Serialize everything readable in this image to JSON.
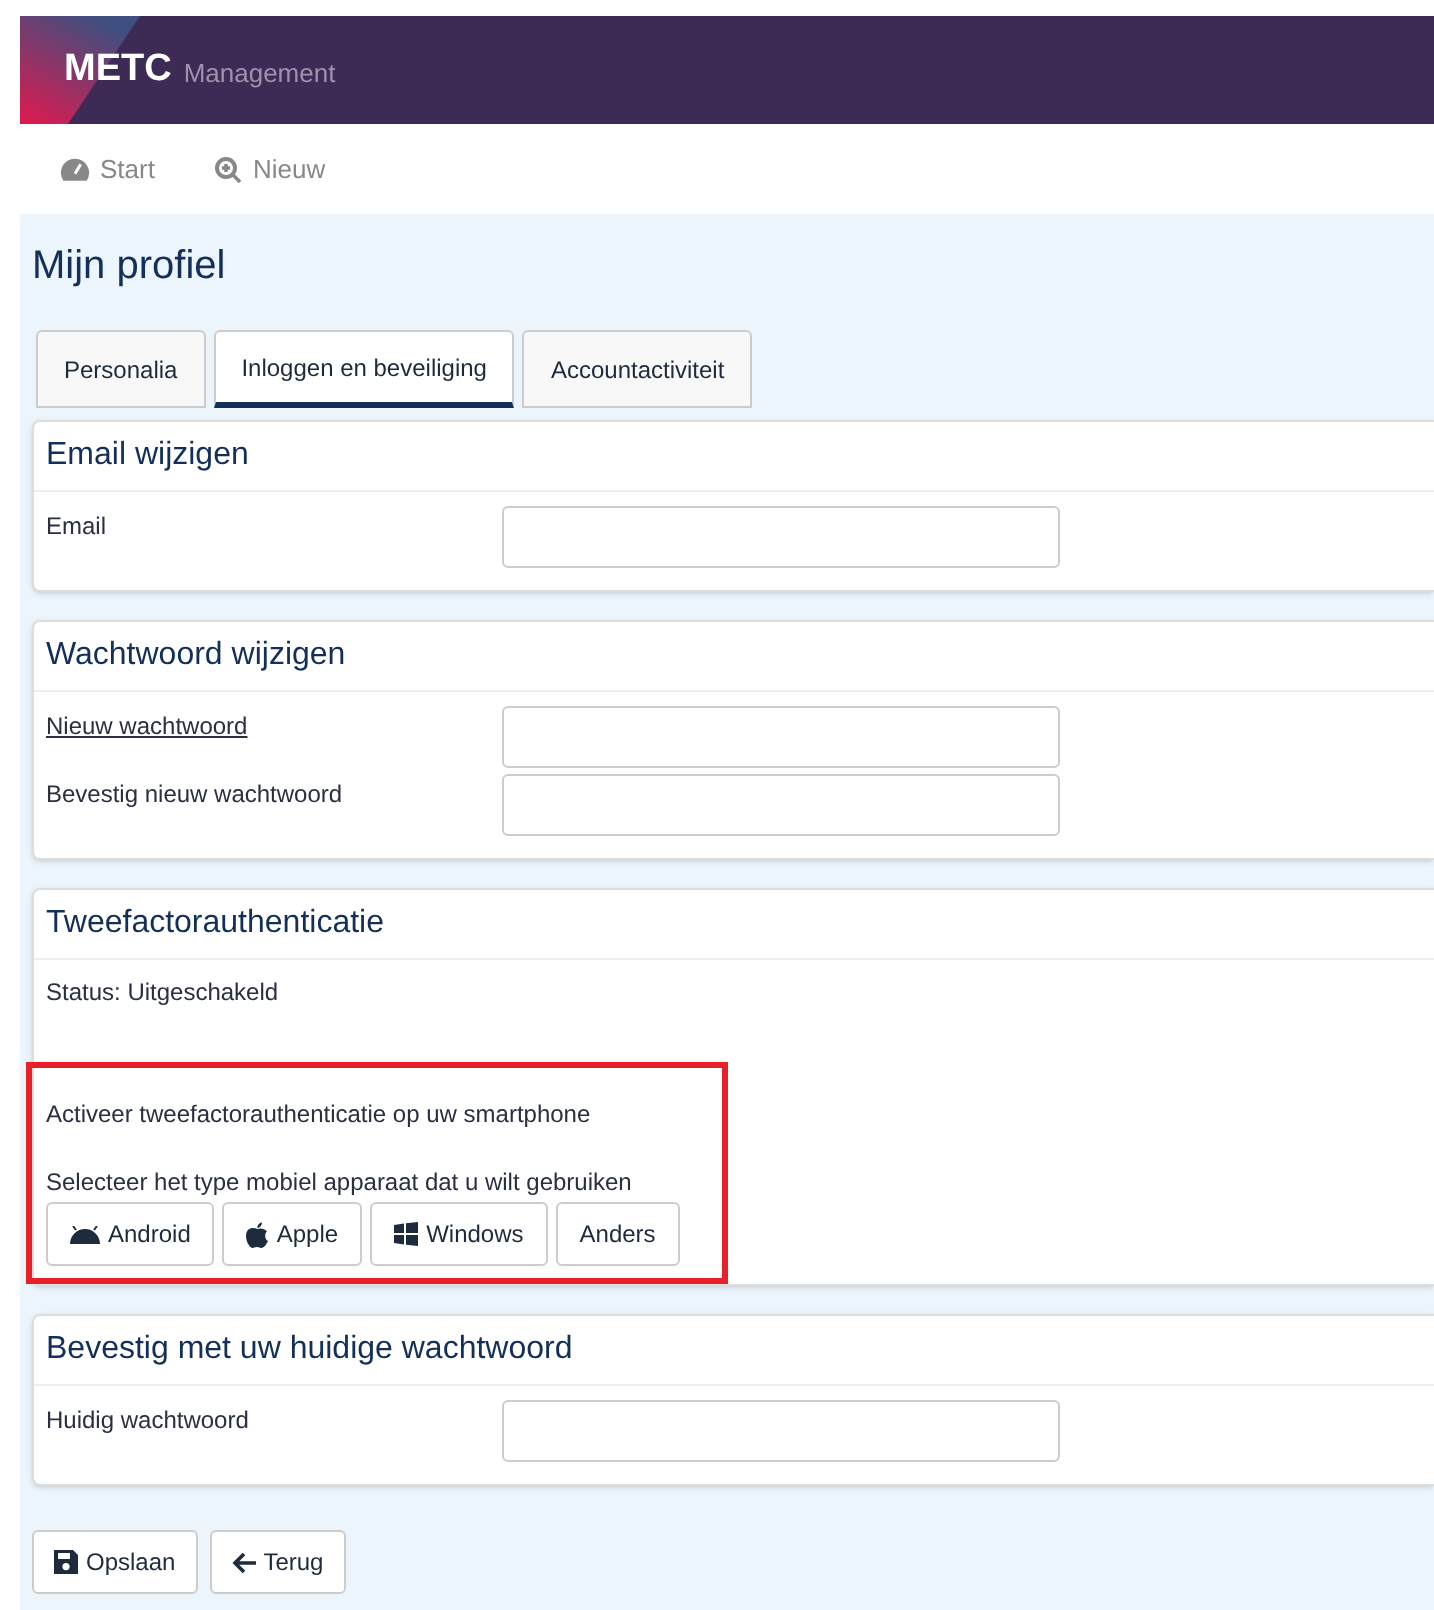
{
  "header": {
    "brand": "METC",
    "subtitle": "Management"
  },
  "nav": [
    {
      "kind": "dashboard",
      "label": "Start"
    },
    {
      "kind": "zoom",
      "label": "Nieuw"
    }
  ],
  "page_title": "Mijn profiel",
  "tabs": [
    {
      "label": "Personalia",
      "selected": false
    },
    {
      "label": "Inloggen en beveiliging",
      "selected": true
    },
    {
      "label": "Accountactiviteit",
      "selected": false
    }
  ],
  "sections": [
    {
      "kind": "fields",
      "title": "Email wijzigen",
      "fields": [
        {
          "label": "Email",
          "underlined": false
        }
      ]
    },
    {
      "kind": "fields",
      "title": "Wachtwoord wijzigen",
      "fields": [
        {
          "label": "Nieuw wachtwoord",
          "underlined": true
        },
        {
          "label": "Bevestig nieuw wachtwoord",
          "underlined": false
        }
      ]
    },
    {
      "kind": "twofactor",
      "title": "Tweefactorauthenticatie",
      "status": "Status: Uitgeschakeld",
      "highlighted": true,
      "intro": "Activeer tweefactorauthenticatie op uw smartphone",
      "prompt": "Selecteer het type mobiel apparaat dat u wilt gebruiken",
      "devices": [
        {
          "kind": "android",
          "label": "Android"
        },
        {
          "kind": "apple",
          "label": "Apple"
        },
        {
          "kind": "windows",
          "label": "Windows"
        },
        {
          "kind": "other",
          "label": "Anders"
        }
      ]
    },
    {
      "kind": "fields",
      "title": "Bevestig met uw huidige wachtwoord",
      "fields": [
        {
          "label": "Huidig wachtwoord",
          "underlined": false
        }
      ]
    }
  ],
  "actions": [
    {
      "kind": "save",
      "label": "Opslaan"
    },
    {
      "kind": "back",
      "label": "Terug"
    }
  ]
}
